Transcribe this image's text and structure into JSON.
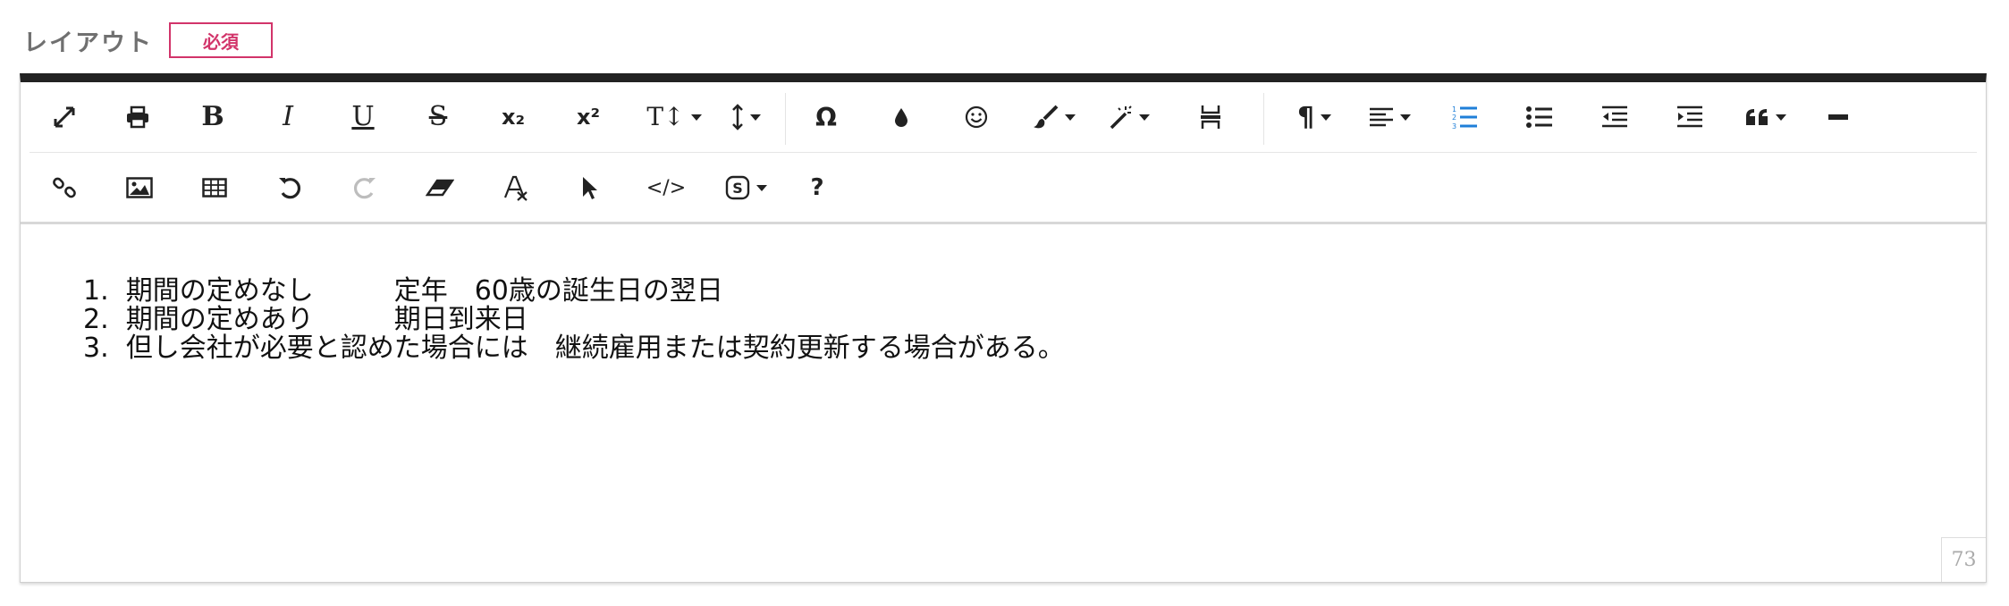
{
  "field": {
    "label": "レイアウト",
    "required_badge": "必須"
  },
  "toolbar": {
    "row1": [
      "expand-icon",
      "print-icon",
      "bold-icon",
      "italic-icon",
      "underline-icon",
      "strikethrough-icon",
      "subscript-icon",
      "superscript-icon",
      "font-size-icon",
      "line-height-icon",
      "special-char-icon",
      "color-icon",
      "emoticon-icon",
      "paint-format-icon",
      "magic-wand-icon",
      "page-break-icon",
      "paragraph-format-icon",
      "align-icon",
      "ordered-list-icon",
      "unordered-list-icon",
      "outdent-icon",
      "indent-icon",
      "quote-icon",
      "horizontal-line-icon"
    ],
    "row2": [
      "link-icon",
      "image-icon",
      "table-icon",
      "undo-icon",
      "redo-icon",
      "eraser-icon",
      "clear-format-icon",
      "select-all-icon",
      "code-view-icon",
      "special-s-icon",
      "help-icon"
    ],
    "labels": {
      "bold": "B",
      "italic": "I",
      "underline": "U",
      "strike": "S",
      "sub": "x₂",
      "sup": "x²",
      "font_size": "T↕",
      "omega": "Ω",
      "pilcrow": "¶",
      "help": "?",
      "code": "</>"
    }
  },
  "content": {
    "items": [
      "1.  期間の定めなし　　　定年　60歳の誕生日の翌日",
      "2.  期間の定めあり　　　期日到来日",
      "3.  但し会社が必要と認めた場合には　継続雇用または契約更新する場合がある。"
    ]
  },
  "char_count": "73",
  "colors": {
    "badge": "#d2346a",
    "active_icon": "#1f7fd8",
    "toolbar_top": "#222222"
  }
}
